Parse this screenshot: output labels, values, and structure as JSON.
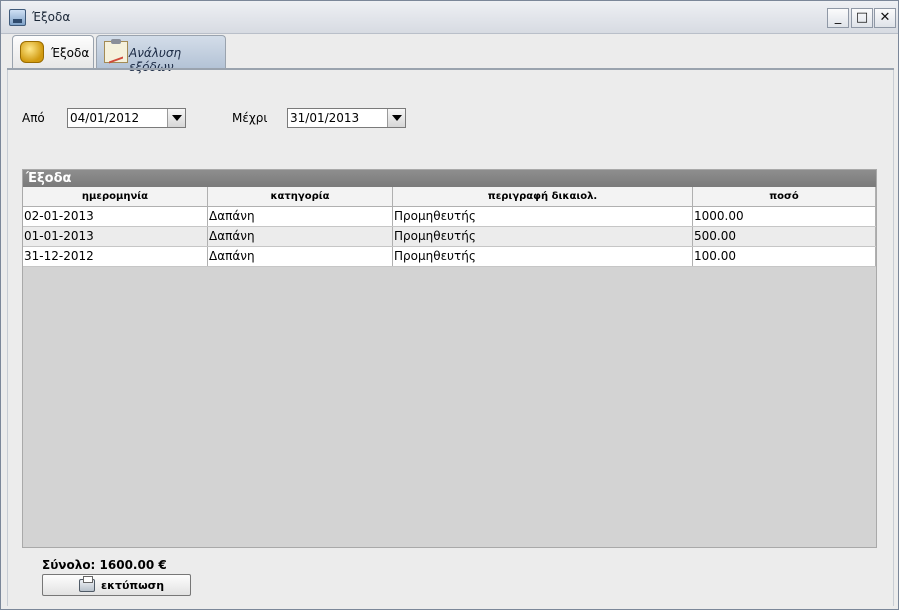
{
  "window": {
    "title": "Έξοδα"
  },
  "tabs": [
    {
      "label": "Έξοδα",
      "icon": "coins-icon",
      "active": true
    },
    {
      "label": "Ανάλυση εξόδων",
      "icon": "clipboard-chart-icon",
      "active": false
    }
  ],
  "filters": {
    "from_label": "Από",
    "from_value": "04/01/2012",
    "to_label": "Μέχρι",
    "to_value": "31/01/2013"
  },
  "grid": {
    "title": "Έξοδα",
    "columns": [
      "ημερομηνία",
      "κατηγορία",
      "περιγραφή δικαιολ.",
      "ποσό"
    ],
    "rows": [
      [
        "02-01-2013",
        "Δαπάνη",
        "Προμηθευτής",
        "1000.00"
      ],
      [
        "01-01-2013",
        "Δαπάνη",
        "Προμηθευτής",
        "500.00"
      ],
      [
        "31-12-2012",
        "Δαπάνη",
        "Προμηθευτής",
        "100.00"
      ]
    ]
  },
  "footer": {
    "total": "Σύνολο: 1600.00 €",
    "print_label": "εκτύπωση"
  }
}
